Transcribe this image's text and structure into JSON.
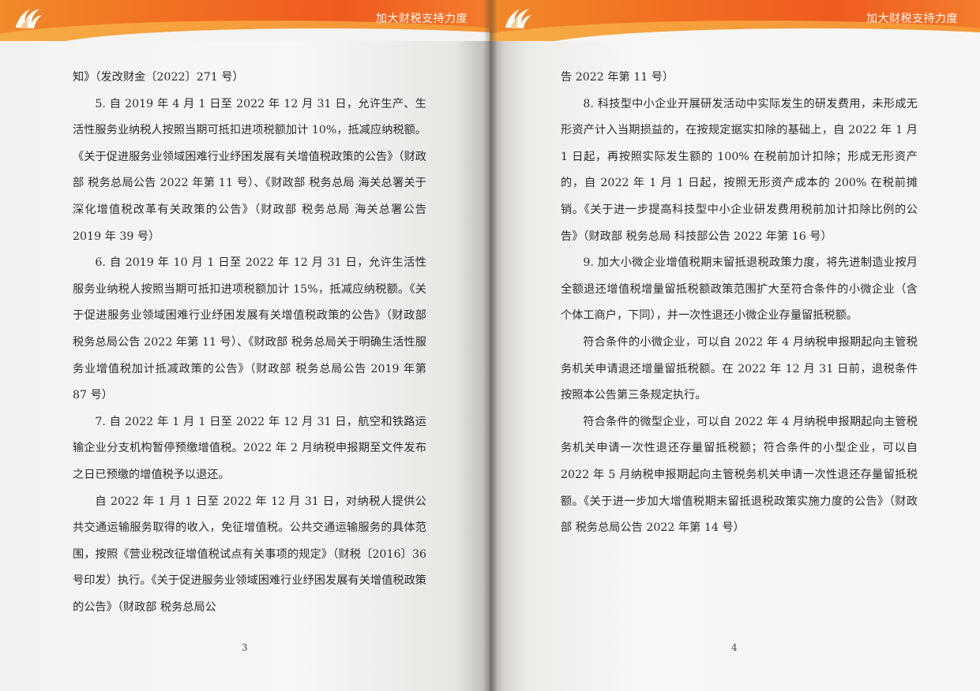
{
  "header": {
    "title": "加大财税支持力度"
  },
  "left_page": {
    "paragraphs": [
      {
        "indent": false,
        "text": "知》（发改财金〔2022〕271 号）"
      },
      {
        "indent": true,
        "text": "5. 自 2019 年 4 月 1 日至 2022 年 12 月 31 日，允许生产、生活性服务业纳税人按照当期可抵扣进项税额加计 10%，抵减应纳税额。《关于促进服务业领域困难行业纾困发展有关增值税政策的公告》（财政部 税务总局公告 2022 年第 11 号）、《财政部 税务总局 海关总署关于深化增值税改革有关政策的公告》（财政部 税务总局 海关总署公告 2019 年 39 号）"
      },
      {
        "indent": true,
        "text": "6. 自 2019 年 10 月 1 日至 2022 年 12 月 31 日，允许生活性服务业纳税人按照当期可抵扣进项税额加计 15%，抵减应纳税额。《关于促进服务业领域困难行业纾困发展有关增值税政策的公告》（财政部 税务总局公告 2022 年第 11 号）、《财政部 税务总局关于明确生活性服务业增值税加计抵减政策的公告》（财政部 税务总局公告 2019 年第 87 号）"
      },
      {
        "indent": true,
        "text": "7. 自 2022 年 1 月 1 日至 2022 年 12 月 31 日，航空和铁路运输企业分支机构暂停预缴增值税。2022 年 2 月纳税申报期至文件发布之日已预缴的增值税予以退还。"
      },
      {
        "indent": true,
        "text": "自 2022 年 1 月 1 日至 2022 年 12 月 31 日，对纳税人提供公共交通运输服务取得的收入，免征增值税。公共交通运输服务的具体范围，按照《营业税改征增值税试点有关事项的规定》（财税〔2016〕36 号印发）执行。《关于促进服务业领域困难行业纾困发展有关增值税政策的公告》（财政部 税务总局公"
      }
    ],
    "page_number": "3"
  },
  "right_page": {
    "paragraphs": [
      {
        "indent": false,
        "text": "告 2022 年第 11 号）"
      },
      {
        "indent": true,
        "text": "8. 科技型中小企业开展研发活动中实际发生的研发费用，未形成无形资产计入当期损益的，在按规定据实扣除的基础上，自 2022 年 1 月 1 日起，再按照实际发生额的 100% 在税前加计扣除；形成无形资产的，自 2022 年 1 月 1 日起，按照无形资产成本的 200% 在税前摊销。《关于进一步提高科技型中小企业研发费用税前加计扣除比例的公告》（财政部 税务总局 科技部公告 2022 年第 16 号）"
      },
      {
        "indent": true,
        "text": "9. 加大小微企业增值税期末留抵退税政策力度，将先进制造业按月全额退还增值税增量留抵税额政策范围扩大至符合条件的小微企业（含个体工商户，下同），并一次性退还小微企业存量留抵税额。"
      },
      {
        "indent": true,
        "text": "符合条件的小微企业，可以自 2022 年 4 月纳税申报期起向主管税务机关申请退还增量留抵税额。在 2022 年 12 月 31 日前，退税条件按照本公告第三条规定执行。"
      },
      {
        "indent": true,
        "text": "符合条件的微型企业，可以自 2022 年 4 月纳税申报期起向主管税务机关申请一次性退还存量留抵税额；符合条件的小型企业，可以自 2022 年 5 月纳税申报期起向主管税务机关申请一次性退还存量留抵税额。《关于进一步加大增值税期末留抵退税政策实施力度的公告》（财政部 税务总局公告 2022 年第 14 号）"
      }
    ],
    "page_number": "4"
  },
  "colors": {
    "header_orange": "#f26f22",
    "header_light": "#f7b24a",
    "paper": "#f7f6f4",
    "text": "#2b2b2b"
  },
  "icons": {
    "logo": "flame-wing-logo-icon"
  }
}
